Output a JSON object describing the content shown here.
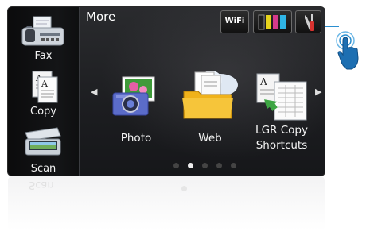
{
  "sidebar": {
    "items": [
      {
        "label": "Fax",
        "icon": "fax-icon"
      },
      {
        "label": "Copy",
        "icon": "copy-icon"
      },
      {
        "label": "Scan",
        "icon": "scan-icon"
      }
    ]
  },
  "header": {
    "title": "More",
    "wifi_label": "WiFi",
    "ink_icon": "ink-levels-icon",
    "tools_icon": "tools-icon"
  },
  "main": {
    "apps": [
      {
        "label": "Photo",
        "icon": "photo-icon"
      },
      {
        "label": "Web",
        "icon": "web-icon"
      },
      {
        "label_line1": "LGR Copy",
        "label_line2": "Shortcuts",
        "icon": "lgr-copy-icon"
      }
    ],
    "page_count": 5,
    "active_page": 2
  },
  "colors": {
    "accent_blue": "#2b8fd0",
    "ink": [
      "#222222",
      "#e6d31c",
      "#d63a8a",
      "#2fb5e6"
    ]
  },
  "reflection": {
    "label": "Scan"
  }
}
